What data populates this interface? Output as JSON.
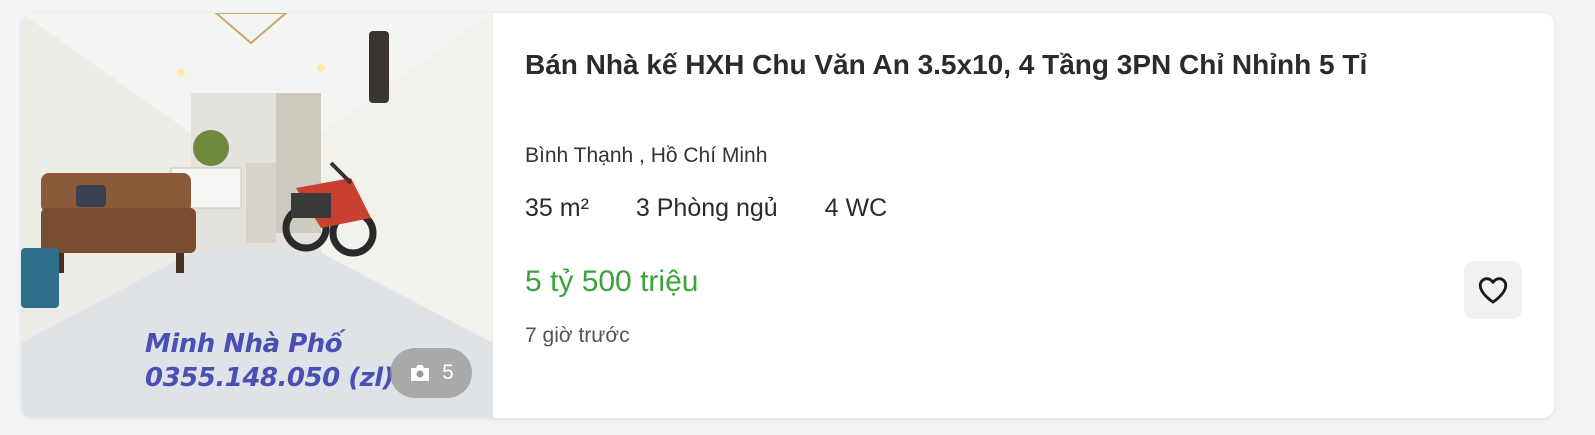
{
  "listing": {
    "title": "Bán Nhà kế HXH Chu Văn An 3.5x10, 4 Tầng 3PN Chỉ Nhỉnh 5 Tỉ",
    "location": "Bình Thạnh , Hồ Chí Minh",
    "area": "35 m²",
    "bedrooms": "3 Phòng ngủ",
    "bathrooms": "4 WC",
    "price": "5 tỷ 500 triệu",
    "posted": "7 giờ trước",
    "photo_count": "5",
    "watermark_line1": "Minh Nhà Phố",
    "watermark_line2": "0355.148.050 (zl)",
    "price_color": "#3aa43a",
    "icons": {
      "photo": "camera-icon",
      "favorite": "heart-outline-icon"
    }
  }
}
